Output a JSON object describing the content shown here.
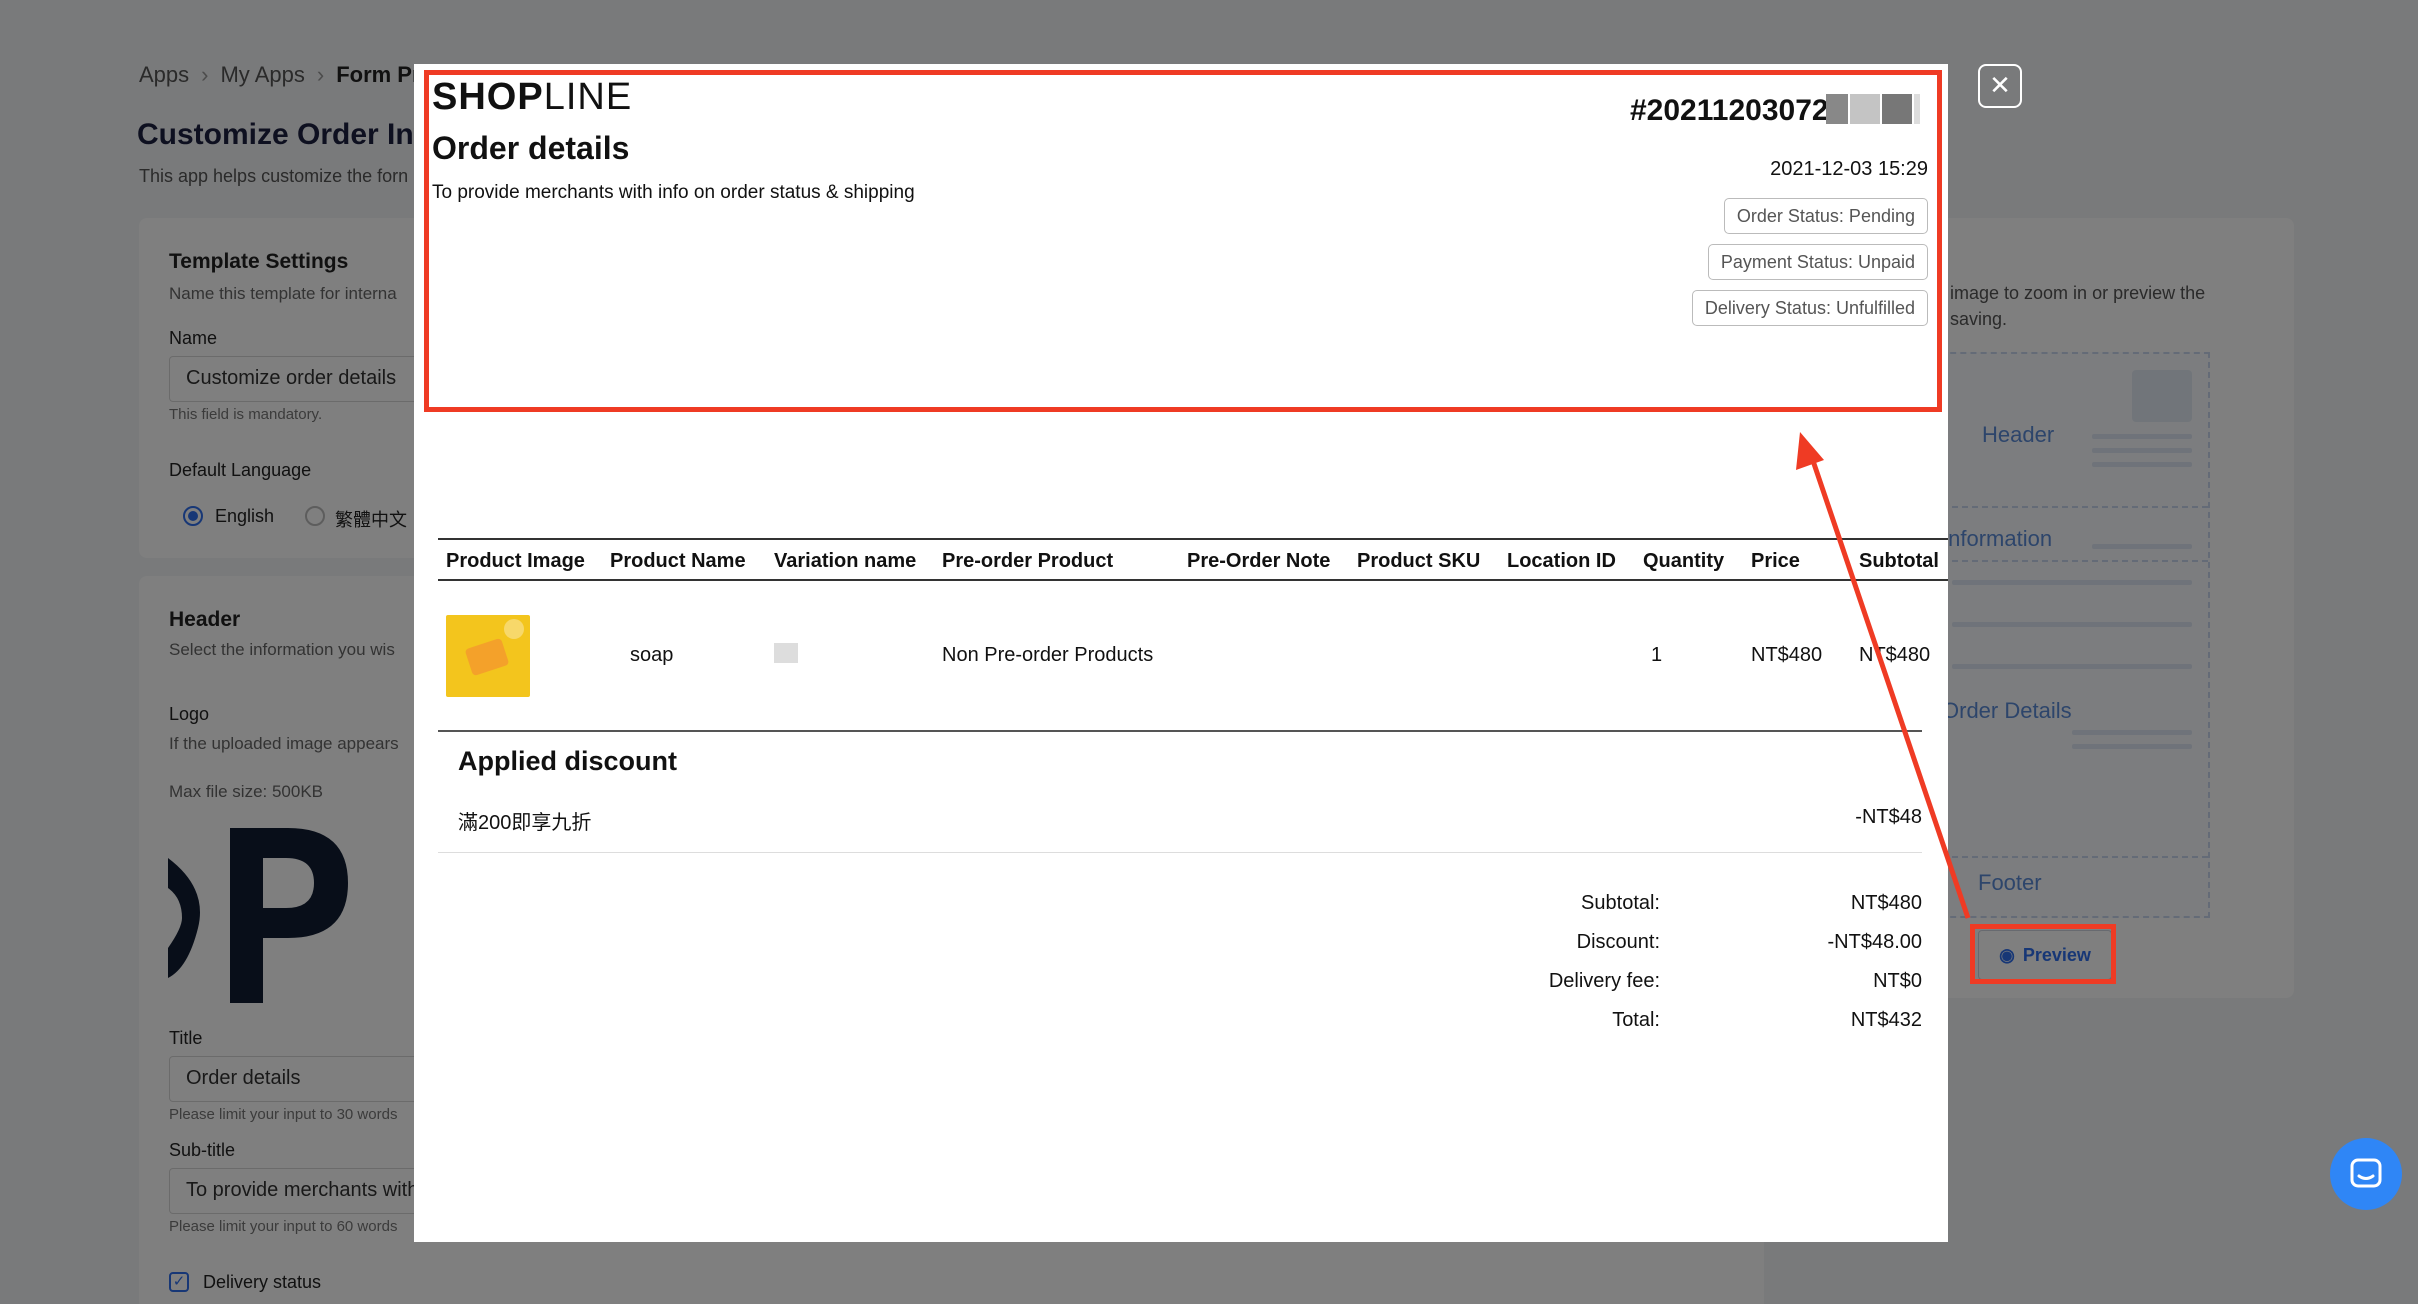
{
  "breadcrumb": {
    "item1": "Apps",
    "item2": "My Apps",
    "item3": "Form Prin"
  },
  "page": {
    "title": "Customize Order Inv",
    "description": "This app helps customize the forn"
  },
  "template_settings": {
    "heading": "Template Settings",
    "hint": "Name this template for interna",
    "name_label": "Name",
    "name_value": "Customize order details",
    "name_hint": "This field is mandatory.",
    "language_label": "Default Language",
    "language_options": [
      "English",
      "繁體中文"
    ],
    "language_selected": "English"
  },
  "header_settings": {
    "heading": "Header",
    "hint": "Select the information you wis",
    "logo_label": "Logo",
    "logo_hint": "If the uploaded image appears",
    "max_size": "Max file size: 500KB",
    "title_label": "Title",
    "title_value": "Order details",
    "title_hint": "Please limit your input to 30 words",
    "subtitle_label": "Sub-title",
    "subtitle_value": "To provide merchants with",
    "subtitle_hint": "Please limit your input to 60 words",
    "delivery_status_label": "Delivery status"
  },
  "layout_panel": {
    "hint_line1": "image to zoom in or preview the",
    "hint_line2": "saving.",
    "sections": [
      "Header",
      "Information",
      "Order Details",
      "Footer"
    ],
    "preview_label": "Preview"
  },
  "modal": {
    "logo_bold": "SHOP",
    "logo_thin": "LINE",
    "title": "Order details",
    "subtitle": "To provide merchants with info on order status & shipping",
    "order_number": "#20211203072",
    "date": "2021-12-03 15:29",
    "order_status": "Order Status: Pending",
    "payment_status": "Payment Status: Unpaid",
    "delivery_status": "Delivery Status: Unfulfilled",
    "close_symbol": "✕",
    "columns": [
      "Product Image",
      "Product Name",
      "Variation name",
      "Pre-order Product",
      "Pre-Order Note",
      "Product SKU",
      "Location ID",
      "Quantity",
      "Price",
      "Subtotal"
    ],
    "items": [
      {
        "name": "soap",
        "preorder": "Non Pre-order Products",
        "quantity": "1",
        "price": "NT$480",
        "subtotal": "NT$480"
      }
    ],
    "discount_heading": "Applied discount",
    "discount_name": "滿200即享九折",
    "discount_amount": "-NT$48",
    "summary": [
      {
        "label": "Subtotal:",
        "value": "NT$480"
      },
      {
        "label": "Discount:",
        "value": "-NT$48.00"
      },
      {
        "label": "Delivery fee:",
        "value": "NT$0"
      },
      {
        "label": "Total:",
        "value": "NT$432"
      }
    ]
  },
  "colors": {
    "annotation_red": "#ef3b24",
    "accent_blue": "#2f6fed",
    "chat_blue": "#2f86f6"
  }
}
